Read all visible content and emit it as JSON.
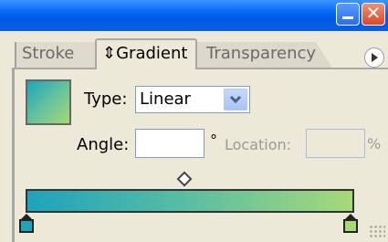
{
  "tabs": [
    {
      "label": "Stroke"
    },
    {
      "label": "Gradient"
    },
    {
      "label": "Transparency"
    }
  ],
  "gradient_tab_icon": "updown-arrows-icon",
  "type": {
    "label": "Type:",
    "value": "Linear"
  },
  "angle": {
    "label": "Angle:",
    "value": "",
    "unit": "°"
  },
  "location": {
    "label": "Location:",
    "value": "",
    "unit": "%"
  },
  "gradient": {
    "start_color": "#1ea3bc",
    "end_color": "#a6d979",
    "midpoint_percent": 50,
    "stops": [
      0,
      100
    ]
  },
  "window_buttons": [
    "minimize-icon",
    "close-icon"
  ]
}
